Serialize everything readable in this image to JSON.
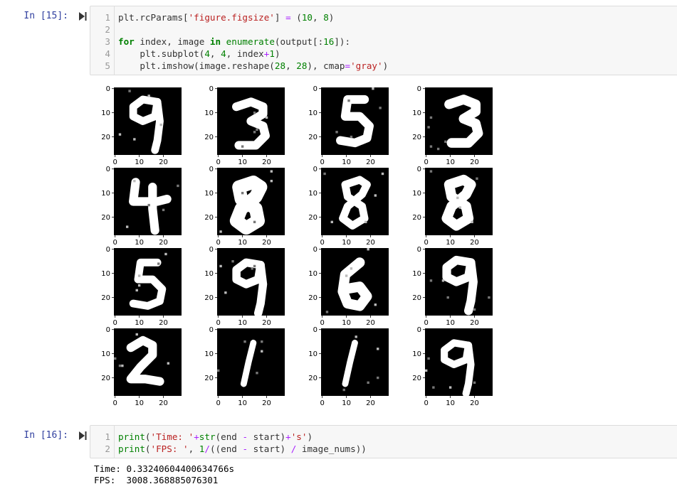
{
  "cells": [
    {
      "prompt": "In [15]:",
      "lines": [
        {
          "n": "1",
          "tokens": [
            [
              "plt.rcParams[",
              ""
            ],
            [
              "'figure.figsize'",
              "str"
            ],
            [
              "] ",
              ""
            ],
            [
              "=",
              "op"
            ],
            [
              " (",
              ""
            ],
            [
              "10",
              "num"
            ],
            [
              ", ",
              ""
            ],
            [
              "8",
              "num"
            ],
            [
              ")",
              ""
            ]
          ]
        },
        {
          "n": "2",
          "tokens": []
        },
        {
          "n": "3",
          "tokens": [
            [
              "for",
              "kw"
            ],
            [
              " index, image ",
              ""
            ],
            [
              "in",
              "kw"
            ],
            [
              " ",
              ""
            ],
            [
              "enumerate",
              "bi"
            ],
            [
              "(output[:",
              ""
            ],
            [
              "16",
              "num"
            ],
            [
              "]):",
              ""
            ]
          ]
        },
        {
          "n": "4",
          "tokens": [
            [
              "    plt.subplot(",
              ""
            ],
            [
              "4",
              "num"
            ],
            [
              ", ",
              ""
            ],
            [
              "4",
              "num"
            ],
            [
              ", index",
              ""
            ],
            [
              "+",
              "op"
            ],
            [
              "1",
              "num"
            ],
            [
              ")",
              ""
            ]
          ]
        },
        {
          "n": "5",
          "tokens": [
            [
              "    plt.imshow(image.reshape(",
              ""
            ],
            [
              "28",
              "num"
            ],
            [
              ", ",
              ""
            ],
            [
              "28",
              "num"
            ],
            [
              "), cmap",
              ""
            ],
            [
              "=",
              "op"
            ],
            [
              "'gray'",
              "str"
            ],
            [
              ")",
              ""
            ]
          ]
        }
      ]
    },
    {
      "prompt": "In [16]:",
      "lines": [
        {
          "n": "1",
          "tokens": [
            [
              "print",
              "bi"
            ],
            [
              "(",
              ""
            ],
            [
              "'Time: '",
              "str"
            ],
            [
              "+",
              "op"
            ],
            [
              "str",
              "bi"
            ],
            [
              "(end ",
              ""
            ],
            [
              "-",
              "op"
            ],
            [
              " start)",
              ""
            ],
            [
              "+",
              "op"
            ],
            [
              "'s'",
              "str"
            ],
            [
              ")",
              ""
            ]
          ]
        },
        {
          "n": "2",
          "tokens": [
            [
              "print",
              "bi"
            ],
            [
              "(",
              ""
            ],
            [
              "'FPS: '",
              "str"
            ],
            [
              ", ",
              ""
            ],
            [
              "1",
              "num"
            ],
            [
              "/",
              "op"
            ],
            [
              "((end ",
              ""
            ],
            [
              "-",
              "op"
            ],
            [
              " start) ",
              ""
            ],
            [
              "/",
              "op"
            ],
            [
              " image_nums))",
              ""
            ]
          ]
        }
      ]
    }
  ],
  "output": {
    "line1": "Time: 0.33240604400634766s",
    "line2": "FPS:  3008.368885076301"
  },
  "chart_data": {
    "type": "heatmap",
    "layout": "4x4 grid of 28x28 grayscale images",
    "cmap": "gray",
    "panels": 16,
    "x_ticks": [
      "0",
      "10",
      "20"
    ],
    "y_ticks": [
      "0",
      "10",
      "20"
    ],
    "xlim": [
      0,
      27
    ],
    "ylim": [
      27,
      0
    ],
    "digits_depicted": [
      "9",
      "3",
      "5",
      "3",
      "4",
      "8",
      "8",
      "8",
      "5",
      "9",
      "6",
      "9",
      "2",
      "1",
      "1",
      "9"
    ]
  },
  "colors": {
    "prompt": "#303f9f",
    "cell_bg": "#f7f7f7",
    "keyword": "#008000",
    "string": "#ba2121",
    "operator": "#aa22ff"
  }
}
